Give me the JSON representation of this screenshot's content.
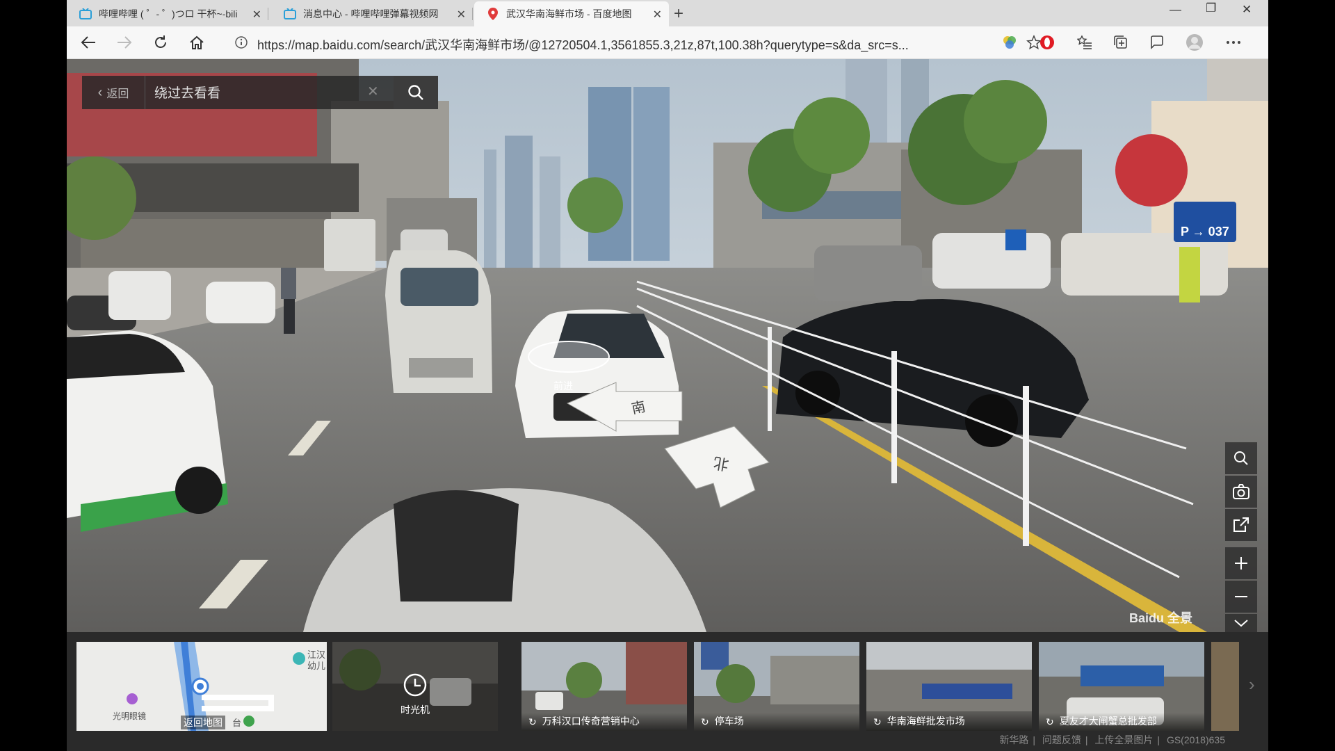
{
  "browser": {
    "tabs": [
      {
        "title": "哔哩哔哩 ( ゜- ゜)つロ 干杯~-bilibili"
      },
      {
        "title": "消息中心 - 哔哩哔哩弹幕视频网"
      },
      {
        "title": "武汉华南海鲜市场 - 百度地图"
      }
    ],
    "url": "https://map.baidu.com/search/武汉华南海鲜市场/@12720504.1,3561855.3,21z,87t,100.38h?querytype=s&da_src=s..."
  },
  "panorama": {
    "back_label": "返回",
    "search_value": "绕过去看看",
    "marker_label": "前进",
    "arrow_south": "南",
    "arrow_north": "北",
    "watermark": "Baidu 全景",
    "tools": [
      "search-icon",
      "camera-icon",
      "share-icon",
      "zoom-in-icon",
      "zoom-out-icon",
      "collapse-icon"
    ]
  },
  "strip": {
    "minimap": {
      "label1": "光明眼镜",
      "label2": "返回地图",
      "label3": "江汉",
      "label4": "幼儿",
      "label5": "台"
    },
    "timemachine": "时光机",
    "thumbs": [
      "万科汉口传奇营销中心",
      "停车场",
      "华南海鲜批发市场",
      "夏友才大闸蟹总批发部"
    ],
    "footer": [
      "新华路",
      "问题反馈",
      "上传全景图片",
      "GS(2018)635"
    ]
  },
  "colors": {
    "accent_blue": "#2b78d8",
    "tab_active": "#f7f7f7",
    "toolbar": "#f7f7f7",
    "dark_panel": "#2a2a2a"
  }
}
